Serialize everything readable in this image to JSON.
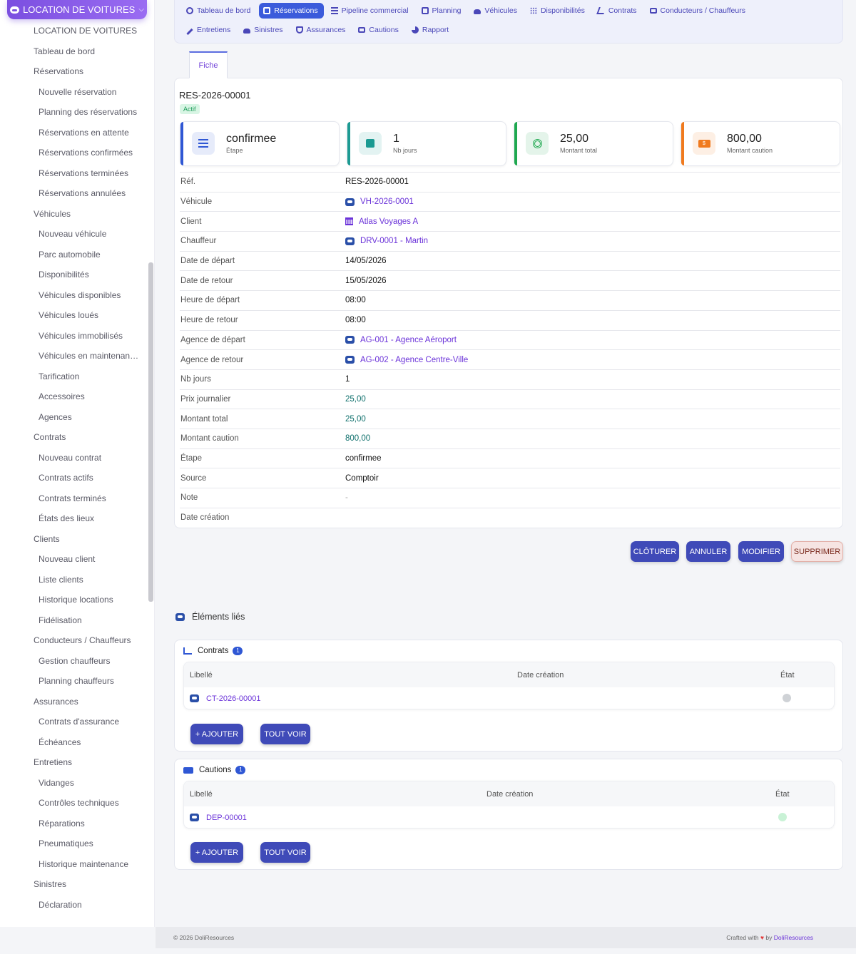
{
  "sidebar": {
    "header": "LOCATION DE VOITURES",
    "items": [
      {
        "label": "LOCATION DE VOITURES",
        "level": 1
      },
      {
        "label": "Tableau de bord",
        "level": 1
      },
      {
        "label": "Réservations",
        "level": 1
      },
      {
        "label": "Nouvelle réservation",
        "level": 2
      },
      {
        "label": "Planning des réservations",
        "level": 2
      },
      {
        "label": "Réservations en attente",
        "level": 2
      },
      {
        "label": "Réservations confirmées",
        "level": 2
      },
      {
        "label": "Réservations terminées",
        "level": 2
      },
      {
        "label": "Réservations annulées",
        "level": 2
      },
      {
        "label": "Véhicules",
        "level": 1
      },
      {
        "label": "Nouveau véhicule",
        "level": 2
      },
      {
        "label": "Parc automobile",
        "level": 2
      },
      {
        "label": "Disponibilités",
        "level": 2
      },
      {
        "label": "Véhicules disponibles",
        "level": 2
      },
      {
        "label": "Véhicules loués",
        "level": 2
      },
      {
        "label": "Véhicules immobilisés",
        "level": 2
      },
      {
        "label": "Véhicules en maintenan…",
        "level": 2
      },
      {
        "label": "Tarification",
        "level": 2
      },
      {
        "label": "Accessoires",
        "level": 2
      },
      {
        "label": "Agences",
        "level": 2
      },
      {
        "label": "Contrats",
        "level": 1
      },
      {
        "label": "Nouveau contrat",
        "level": 2
      },
      {
        "label": "Contrats actifs",
        "level": 2
      },
      {
        "label": "Contrats terminés",
        "level": 2
      },
      {
        "label": "États des lieux",
        "level": 2
      },
      {
        "label": "Clients",
        "level": 1
      },
      {
        "label": "Nouveau client",
        "level": 2
      },
      {
        "label": "Liste clients",
        "level": 2
      },
      {
        "label": "Historique locations",
        "level": 2
      },
      {
        "label": "Fidélisation",
        "level": 2
      },
      {
        "label": "Conducteurs / Chauffeurs",
        "level": 1
      },
      {
        "label": "Gestion chauffeurs",
        "level": 2
      },
      {
        "label": "Planning chauffeurs",
        "level": 2
      },
      {
        "label": "Assurances",
        "level": 1
      },
      {
        "label": "Contrats d'assurance",
        "level": 2
      },
      {
        "label": "Échéances",
        "level": 2
      },
      {
        "label": "Entretiens",
        "level": 1
      },
      {
        "label": "Vidanges",
        "level": 2
      },
      {
        "label": "Contrôles techniques",
        "level": 2
      },
      {
        "label": "Réparations",
        "level": 2
      },
      {
        "label": "Pneumatiques",
        "level": 2
      },
      {
        "label": "Historique maintenance",
        "level": 2
      },
      {
        "label": "Sinistres",
        "level": 1
      },
      {
        "label": "Déclaration",
        "level": 2
      }
    ]
  },
  "topnav": {
    "row1": [
      {
        "label": "Tableau de bord",
        "icon": "dashboard-icon",
        "active": false
      },
      {
        "label": "Réservations",
        "icon": "calendar-icon",
        "active": true
      },
      {
        "label": "Pipeline commercial",
        "icon": "list-icon",
        "active": false
      },
      {
        "label": "Planning",
        "icon": "calendar-icon",
        "active": false
      },
      {
        "label": "Véhicules",
        "icon": "car-icon",
        "active": false
      },
      {
        "label": "Disponibilités",
        "icon": "grid-icon",
        "active": false
      },
      {
        "label": "Contrats",
        "icon": "signature-icon",
        "active": false
      },
      {
        "label": "Conducteurs / Chauffeurs",
        "icon": "id-card-icon",
        "active": false
      }
    ],
    "row2": [
      {
        "label": "Entretiens",
        "icon": "wrench-icon",
        "active": false
      },
      {
        "label": "Sinistres",
        "icon": "car-crash-icon",
        "active": false
      },
      {
        "label": "Assurances",
        "icon": "shield-icon",
        "active": false
      },
      {
        "label": "Cautions",
        "icon": "money-bill-icon",
        "active": false
      },
      {
        "label": "Rapport",
        "icon": "pie-chart-icon",
        "active": false
      }
    ]
  },
  "tab": {
    "label": "Fiche"
  },
  "record": {
    "ref": "RES-2026-00001",
    "status": "Actif",
    "stats": [
      {
        "value": "confirmee",
        "label": "Étape",
        "color": "#2f57d4",
        "icon": "bars-icon"
      },
      {
        "value": "1",
        "label": "Nb jours",
        "color": "#1c9a92",
        "icon": "calendar-icon"
      },
      {
        "value": "25,00",
        "label": "Montant total",
        "color": "#1ea84f",
        "icon": "coins-icon"
      },
      {
        "value": "800,00",
        "label": "Montant caution",
        "color": "#f07a1e",
        "icon": "money-bill-icon"
      }
    ],
    "fields": [
      {
        "label": "Réf.",
        "value": "RES-2026-00001",
        "type": "text"
      },
      {
        "label": "Véhicule",
        "value": "VH-2026-0001",
        "type": "link",
        "icon": "car-object-icon"
      },
      {
        "label": "Client",
        "value": "Atlas Voyages A",
        "type": "link",
        "icon": "company-icon"
      },
      {
        "label": "Chauffeur",
        "value": "DRV-0001 - Martin",
        "type": "link",
        "icon": "car-object-icon"
      },
      {
        "label": "Date de départ",
        "value": "14/05/2026",
        "type": "text"
      },
      {
        "label": "Date de retour",
        "value": "15/05/2026",
        "type": "text"
      },
      {
        "label": "Heure de départ",
        "value": "08:00",
        "type": "text"
      },
      {
        "label": "Heure de retour",
        "value": "08:00",
        "type": "text"
      },
      {
        "label": "Agence de départ",
        "value": "AG-001 - Agence Aéroport",
        "type": "link",
        "icon": "car-object-icon"
      },
      {
        "label": "Agence de retour",
        "value": "AG-002 - Agence Centre-Ville",
        "type": "link",
        "icon": "car-object-icon"
      },
      {
        "label": "Nb jours",
        "value": "1",
        "type": "text"
      },
      {
        "label": "Prix journalier",
        "value": "25,00",
        "type": "num"
      },
      {
        "label": "Montant total",
        "value": "25,00",
        "type": "num"
      },
      {
        "label": "Montant caution",
        "value": "800,00",
        "type": "num"
      },
      {
        "label": "Étape",
        "value": "confirmee",
        "type": "text"
      },
      {
        "label": "Source",
        "value": "Comptoir",
        "type": "text"
      },
      {
        "label": "Note",
        "value": "-",
        "type": "muted"
      },
      {
        "label": "Date création",
        "value": "",
        "type": "text"
      }
    ]
  },
  "actions": {
    "close": "CLÔTURER",
    "cancel": "ANNULER",
    "edit": "MODIFIER",
    "delete": "SUPPRIMER"
  },
  "linked": {
    "title": "Éléments liés",
    "contracts": {
      "title": "Contrats",
      "count": "1",
      "headers": [
        "Libellé",
        "Date création",
        "État"
      ],
      "rows": [
        {
          "label": "CT-2026-00001",
          "date": "",
          "status_color": "#cfd2d6"
        }
      ],
      "add": "+ AJOUTER",
      "all": "TOUT VOIR"
    },
    "deposits": {
      "title": "Cautions",
      "count": "1",
      "headers": [
        "Libellé",
        "Date création",
        "État"
      ],
      "rows": [
        {
          "label": "DEP-00001",
          "date": "",
          "status_color": "#c9f2d6"
        }
      ],
      "add": "+ AJOUTER",
      "all": "TOUT VOIR"
    }
  },
  "footer": {
    "copyright": "© 2026 DoliResources",
    "crafted": "Crafted with",
    "by": "by",
    "brand": "DoliResources"
  }
}
